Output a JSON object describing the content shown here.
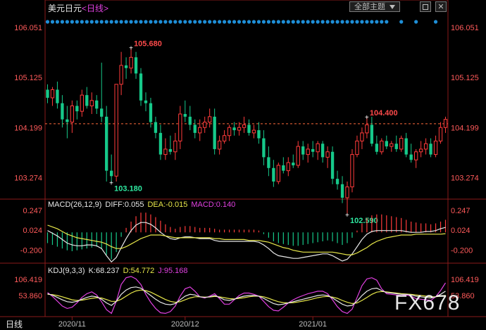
{
  "header": {
    "symbol": "美元日元",
    "timeframe": "<日线>",
    "theme_button": "全部主题",
    "down_icon": "triangle-down-icon",
    "restore_icon": "restore-window-icon",
    "close_icon": "close-icon"
  },
  "timeframe_label": "日线",
  "watermark": "FX678",
  "colors": {
    "up": "#ff3b3b",
    "down": "#16c98a",
    "dot": "#1e8fd8",
    "yellow": "#e8e84a",
    "magenta": "#e040e0",
    "white": "#e8e8e8",
    "ref": "#ff6a3d"
  },
  "macd": {
    "label": "MACD(26,12,9)",
    "diff": "DIFF:0.055",
    "dea": "DEA:-0.015",
    "macd": "MACD:0.140"
  },
  "kdj": {
    "label": "KDJ(9,3,3)",
    "k": "K:68.237",
    "d": "D:54.772",
    "j": "J:95.168"
  },
  "chart_data": {
    "type": "candlestick",
    "price_axis": {
      "ylim": [
        102.9,
        106.3
      ],
      "ticks": [
        "106.051",
        "105.125",
        "104.199",
        "103.274"
      ],
      "tick_values": [
        106.051,
        105.125,
        104.199,
        103.274
      ]
    },
    "reference_line": 104.27,
    "macd_axis": {
      "ticks": [
        "0.247",
        "0.024",
        "-0.200"
      ]
    },
    "kdj_axis": {
      "ticks": [
        "106.419",
        "53.860"
      ]
    },
    "x_labels": [
      "2020/11",
      "2020/12",
      "2021/01"
    ],
    "annotations": [
      {
        "text": "105.680",
        "value": 105.68,
        "color": "#ff4a4a"
      },
      {
        "text": "103.180",
        "value": 103.18,
        "color": "#2ee8a0"
      },
      {
        "text": "104.400",
        "value": 104.4,
        "color": "#ff4a4a"
      },
      {
        "text": "102.590",
        "value": 102.59,
        "color": "#2ee8a0"
      }
    ],
    "candles": [
      {
        "o": 104.9,
        "h": 105.0,
        "l": 104.65,
        "c": 104.75
      },
      {
        "o": 104.75,
        "h": 104.95,
        "l": 104.6,
        "c": 104.9
      },
      {
        "o": 104.9,
        "h": 105.05,
        "l": 104.55,
        "c": 104.65
      },
      {
        "o": 104.65,
        "h": 104.8,
        "l": 104.2,
        "c": 104.35
      },
      {
        "o": 104.35,
        "h": 104.6,
        "l": 104.0,
        "c": 104.3
      },
      {
        "o": 104.3,
        "h": 104.7,
        "l": 104.1,
        "c": 104.6
      },
      {
        "o": 104.6,
        "h": 104.7,
        "l": 104.35,
        "c": 104.5
      },
      {
        "o": 104.5,
        "h": 104.9,
        "l": 104.4,
        "c": 104.8
      },
      {
        "o": 104.8,
        "h": 104.95,
        "l": 104.55,
        "c": 104.6
      },
      {
        "o": 104.6,
        "h": 104.85,
        "l": 104.45,
        "c": 104.7
      },
      {
        "o": 104.7,
        "h": 104.8,
        "l": 104.45,
        "c": 104.55
      },
      {
        "o": 104.55,
        "h": 105.4,
        "l": 104.3,
        "c": 104.4
      },
      {
        "o": 104.4,
        "h": 104.6,
        "l": 103.2,
        "c": 103.4
      },
      {
        "o": 103.4,
        "h": 103.7,
        "l": 103.18,
        "c": 103.3
      },
      {
        "o": 103.3,
        "h": 105.0,
        "l": 103.2,
        "c": 105.0
      },
      {
        "o": 105.0,
        "h": 105.6,
        "l": 104.8,
        "c": 105.35
      },
      {
        "o": 105.35,
        "h": 105.5,
        "l": 105.1,
        "c": 105.3
      },
      {
        "o": 105.3,
        "h": 105.68,
        "l": 105.2,
        "c": 105.5
      },
      {
        "o": 105.5,
        "h": 105.6,
        "l": 105.1,
        "c": 105.2
      },
      {
        "o": 105.2,
        "h": 105.3,
        "l": 104.6,
        "c": 104.7
      },
      {
        "o": 104.7,
        "h": 104.85,
        "l": 104.5,
        "c": 104.65
      },
      {
        "o": 104.65,
        "h": 104.75,
        "l": 104.2,
        "c": 104.3
      },
      {
        "o": 104.3,
        "h": 104.4,
        "l": 104.0,
        "c": 104.1
      },
      {
        "o": 104.1,
        "h": 104.25,
        "l": 103.6,
        "c": 103.7
      },
      {
        "o": 103.7,
        "h": 104.0,
        "l": 103.6,
        "c": 103.8
      },
      {
        "o": 103.8,
        "h": 104.05,
        "l": 103.7,
        "c": 103.75
      },
      {
        "o": 103.75,
        "h": 104.1,
        "l": 103.6,
        "c": 103.95
      },
      {
        "o": 103.95,
        "h": 104.6,
        "l": 103.8,
        "c": 104.45
      },
      {
        "o": 104.45,
        "h": 104.7,
        "l": 104.3,
        "c": 104.4
      },
      {
        "o": 104.4,
        "h": 104.6,
        "l": 104.15,
        "c": 104.25
      },
      {
        "o": 104.25,
        "h": 104.35,
        "l": 104.0,
        "c": 104.1
      },
      {
        "o": 104.1,
        "h": 104.35,
        "l": 103.95,
        "c": 104.2
      },
      {
        "o": 104.2,
        "h": 104.4,
        "l": 104.1,
        "c": 104.3
      },
      {
        "o": 104.3,
        "h": 104.55,
        "l": 104.2,
        "c": 104.4
      },
      {
        "o": 104.4,
        "h": 104.55,
        "l": 103.7,
        "c": 103.8
      },
      {
        "o": 103.8,
        "h": 104.05,
        "l": 103.7,
        "c": 103.95
      },
      {
        "o": 103.95,
        "h": 104.15,
        "l": 103.9,
        "c": 104.05
      },
      {
        "o": 104.05,
        "h": 104.25,
        "l": 103.95,
        "c": 104.2
      },
      {
        "o": 104.2,
        "h": 104.3,
        "l": 104.05,
        "c": 104.15
      },
      {
        "o": 104.15,
        "h": 104.3,
        "l": 104.05,
        "c": 104.2
      },
      {
        "o": 104.2,
        "h": 104.4,
        "l": 104.1,
        "c": 104.25
      },
      {
        "o": 104.25,
        "h": 104.35,
        "l": 104.05,
        "c": 104.1
      },
      {
        "o": 104.1,
        "h": 104.25,
        "l": 104.0,
        "c": 104.15
      },
      {
        "o": 104.15,
        "h": 104.3,
        "l": 103.9,
        "c": 104.0
      },
      {
        "o": 104.0,
        "h": 104.15,
        "l": 103.5,
        "c": 103.65
      },
      {
        "o": 103.65,
        "h": 103.85,
        "l": 103.3,
        "c": 103.45
      },
      {
        "o": 103.45,
        "h": 103.6,
        "l": 103.1,
        "c": 103.2
      },
      {
        "o": 103.2,
        "h": 103.55,
        "l": 103.15,
        "c": 103.5
      },
      {
        "o": 103.5,
        "h": 103.65,
        "l": 103.35,
        "c": 103.4
      },
      {
        "o": 103.4,
        "h": 103.65,
        "l": 103.3,
        "c": 103.55
      },
      {
        "o": 103.55,
        "h": 103.7,
        "l": 103.45,
        "c": 103.5
      },
      {
        "o": 103.5,
        "h": 103.95,
        "l": 103.45,
        "c": 103.85
      },
      {
        "o": 103.85,
        "h": 103.95,
        "l": 103.6,
        "c": 103.7
      },
      {
        "o": 103.7,
        "h": 103.9,
        "l": 103.55,
        "c": 103.8
      },
      {
        "o": 103.8,
        "h": 103.95,
        "l": 103.65,
        "c": 103.75
      },
      {
        "o": 103.75,
        "h": 103.95,
        "l": 103.6,
        "c": 103.9
      },
      {
        "o": 103.9,
        "h": 103.95,
        "l": 103.55,
        "c": 103.65
      },
      {
        "o": 103.65,
        "h": 103.85,
        "l": 103.45,
        "c": 103.75
      },
      {
        "o": 103.75,
        "h": 103.85,
        "l": 103.15,
        "c": 103.25
      },
      {
        "o": 103.25,
        "h": 103.4,
        "l": 103.05,
        "c": 103.15
      },
      {
        "o": 103.15,
        "h": 103.3,
        "l": 102.8,
        "c": 102.9
      },
      {
        "o": 102.9,
        "h": 103.2,
        "l": 102.59,
        "c": 103.1
      },
      {
        "o": 103.1,
        "h": 103.8,
        "l": 103.0,
        "c": 103.7
      },
      {
        "o": 103.7,
        "h": 104.05,
        "l": 103.65,
        "c": 103.95
      },
      {
        "o": 103.95,
        "h": 104.2,
        "l": 103.8,
        "c": 104.1
      },
      {
        "o": 104.1,
        "h": 104.4,
        "l": 104.0,
        "c": 104.25
      },
      {
        "o": 104.25,
        "h": 104.4,
        "l": 103.85,
        "c": 103.9
      },
      {
        "o": 103.9,
        "h": 104.05,
        "l": 103.7,
        "c": 103.75
      },
      {
        "o": 103.75,
        "h": 104.0,
        "l": 103.7,
        "c": 103.95
      },
      {
        "o": 103.95,
        "h": 104.05,
        "l": 103.8,
        "c": 103.85
      },
      {
        "o": 103.85,
        "h": 103.95,
        "l": 103.75,
        "c": 103.9
      },
      {
        "o": 103.9,
        "h": 104.05,
        "l": 103.75,
        "c": 103.8
      },
      {
        "o": 103.8,
        "h": 104.05,
        "l": 103.75,
        "c": 104.0
      },
      {
        "o": 104.0,
        "h": 104.1,
        "l": 103.65,
        "c": 103.7
      },
      {
        "o": 103.7,
        "h": 103.9,
        "l": 103.55,
        "c": 103.6
      },
      {
        "o": 103.6,
        "h": 103.8,
        "l": 103.45,
        "c": 103.75
      },
      {
        "o": 103.75,
        "h": 103.95,
        "l": 103.65,
        "c": 103.8
      },
      {
        "o": 103.8,
        "h": 104.0,
        "l": 103.7,
        "c": 103.9
      },
      {
        "o": 103.9,
        "h": 104.0,
        "l": 103.65,
        "c": 103.7
      },
      {
        "o": 103.7,
        "h": 104.05,
        "l": 103.65,
        "c": 103.95
      },
      {
        "o": 103.95,
        "h": 104.3,
        "l": 103.9,
        "c": 104.2
      },
      {
        "o": 104.2,
        "h": 104.4,
        "l": 104.1,
        "c": 104.35
      }
    ],
    "macd_values": [
      -0.12,
      -0.14,
      -0.16,
      -0.18,
      -0.2,
      -0.21,
      -0.2,
      -0.19,
      -0.18,
      -0.17,
      -0.16,
      -0.18,
      -0.25,
      -0.3,
      -0.22,
      -0.05,
      0.05,
      0.12,
      0.18,
      0.22,
      0.22,
      0.2,
      0.17,
      0.13,
      0.09,
      0.06,
      0.04,
      0.06,
      0.07,
      0.07,
      0.06,
      0.05,
      0.05,
      0.05,
      0.04,
      0.03,
      0.03,
      0.03,
      0.03,
      0.03,
      0.03,
      0.03,
      0.03,
      0.02,
      -0.02,
      -0.06,
      -0.1,
      -0.12,
      -0.13,
      -0.14,
      -0.15,
      -0.15,
      -0.14,
      -0.13,
      -0.12,
      -0.11,
      -0.1,
      -0.09,
      -0.1,
      -0.12,
      -0.14,
      -0.12,
      -0.06,
      0.02,
      0.1,
      0.16,
      0.19,
      0.2,
      0.2,
      0.19,
      0.18,
      0.17,
      0.16,
      0.14,
      0.12,
      0.11,
      0.1,
      0.1,
      0.09,
      0.1,
      0.12,
      0.14
    ],
    "macd_diff": [
      0.02,
      -0.01,
      -0.04,
      -0.08,
      -0.12,
      -0.14,
      -0.15,
      -0.15,
      -0.14,
      -0.14,
      -0.15,
      -0.18,
      -0.26,
      -0.33,
      -0.28,
      -0.17,
      -0.07,
      0.02,
      0.08,
      0.11,
      0.11,
      0.09,
      0.05,
      0.0,
      -0.04,
      -0.07,
      -0.08,
      -0.06,
      -0.05,
      -0.05,
      -0.06,
      -0.07,
      -0.07,
      -0.07,
      -0.09,
      -0.1,
      -0.1,
      -0.1,
      -0.1,
      -0.1,
      -0.1,
      -0.1,
      -0.1,
      -0.11,
      -0.14,
      -0.18,
      -0.23,
      -0.26,
      -0.27,
      -0.28,
      -0.29,
      -0.29,
      -0.28,
      -0.27,
      -0.26,
      -0.25,
      -0.24,
      -0.24,
      -0.26,
      -0.29,
      -0.32,
      -0.3,
      -0.24,
      -0.16,
      -0.08,
      -0.02,
      0.01,
      0.02,
      0.02,
      0.02,
      0.02,
      0.02,
      0.02,
      0.01,
      0.0,
      0.0,
      0.0,
      0.01,
      0.01,
      0.02,
      0.04,
      0.055
    ],
    "macd_dea": [
      0.08,
      0.06,
      0.04,
      0.01,
      -0.02,
      -0.04,
      -0.06,
      -0.07,
      -0.08,
      -0.09,
      -0.1,
      -0.11,
      -0.13,
      -0.16,
      -0.18,
      -0.18,
      -0.16,
      -0.13,
      -0.1,
      -0.07,
      -0.05,
      -0.03,
      -0.03,
      -0.03,
      -0.04,
      -0.05,
      -0.06,
      -0.06,
      -0.06,
      -0.06,
      -0.06,
      -0.06,
      -0.06,
      -0.06,
      -0.07,
      -0.07,
      -0.08,
      -0.08,
      -0.08,
      -0.08,
      -0.08,
      -0.09,
      -0.09,
      -0.09,
      -0.1,
      -0.11,
      -0.13,
      -0.15,
      -0.17,
      -0.18,
      -0.2,
      -0.21,
      -0.22,
      -0.22,
      -0.22,
      -0.22,
      -0.22,
      -0.22,
      -0.22,
      -0.23,
      -0.24,
      -0.25,
      -0.25,
      -0.23,
      -0.2,
      -0.17,
      -0.13,
      -0.1,
      -0.08,
      -0.06,
      -0.05,
      -0.04,
      -0.03,
      -0.03,
      -0.03,
      -0.02,
      -0.02,
      -0.02,
      -0.02,
      -0.02,
      -0.02,
      -0.015
    ],
    "kdj_k": [
      60,
      55,
      48,
      40,
      34,
      32,
      35,
      42,
      48,
      52,
      50,
      42,
      30,
      22,
      35,
      58,
      72,
      80,
      82,
      78,
      66,
      54,
      42,
      32,
      26,
      24,
      28,
      40,
      52,
      58,
      56,
      50,
      48,
      50,
      54,
      48,
      40,
      38,
      42,
      48,
      52,
      54,
      54,
      52,
      45,
      36,
      28,
      24,
      26,
      30,
      34,
      38,
      42,
      46,
      50,
      54,
      56,
      54,
      46,
      36,
      26,
      20,
      22,
      36,
      54,
      68,
      76,
      78,
      70,
      64,
      62,
      60,
      58,
      58,
      56,
      52,
      50,
      48,
      46,
      50,
      58,
      68
    ],
    "kdj_d": [
      58,
      57,
      54,
      50,
      45,
      40,
      38,
      39,
      42,
      45,
      47,
      46,
      41,
      35,
      35,
      42,
      52,
      62,
      69,
      72,
      70,
      65,
      57,
      49,
      41,
      35,
      32,
      34,
      40,
      46,
      50,
      50,
      49,
      49,
      51,
      50,
      47,
      44,
      43,
      45,
      47,
      50,
      52,
      52,
      50,
      45,
      39,
      34,
      31,
      30,
      31,
      33,
      36,
      39,
      43,
      47,
      50,
      51,
      49,
      45,
      38,
      32,
      28,
      30,
      38,
      48,
      58,
      65,
      67,
      66,
      64,
      62,
      60,
      59,
      58,
      56,
      54,
      52,
      50,
      50,
      52,
      54.8
    ],
    "kdj_j": [
      64,
      51,
      36,
      20,
      12,
      16,
      30,
      48,
      60,
      66,
      56,
      34,
      8,
      -4,
      35,
      90,
      112,
      116,
      108,
      90,
      58,
      32,
      12,
      -2,
      -4,
      2,
      20,
      52,
      76,
      82,
      68,
      50,
      46,
      52,
      60,
      44,
      26,
      26,
      40,
      54,
      62,
      62,
      58,
      52,
      35,
      18,
      6,
      4,
      16,
      30,
      40,
      48,
      54,
      60,
      64,
      68,
      68,
      60,
      40,
      18,
      2,
      -4,
      10,
      48,
      86,
      108,
      112,
      104,
      76,
      60,
      58,
      56,
      54,
      56,
      52,
      44,
      42,
      40,
      38,
      50,
      70,
      95.2
    ],
    "top_dots": [
      0,
      1,
      2,
      3,
      4,
      5,
      6,
      7,
      8,
      9,
      10,
      11,
      12,
      13,
      14,
      15,
      16,
      17,
      18,
      19,
      20,
      21,
      22,
      23,
      24,
      25,
      26,
      27,
      28,
      29,
      30,
      31,
      32,
      33,
      34,
      35,
      36,
      37,
      38,
      39,
      40,
      41,
      42,
      43,
      44,
      45,
      46,
      47,
      48,
      49,
      50,
      51,
      52,
      53,
      54,
      55,
      56,
      57,
      58,
      59,
      60,
      61,
      62,
      63,
      64,
      65,
      66,
      67,
      68,
      69,
      72,
      75,
      79
    ]
  }
}
